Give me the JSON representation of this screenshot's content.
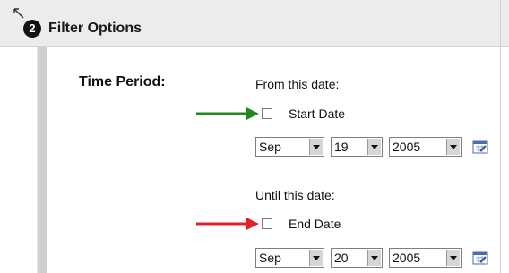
{
  "section": {
    "step_number": "2",
    "title": "Filter Options"
  },
  "time_period": {
    "label": "Time Period:",
    "from": {
      "caption": "From this date:",
      "checkbox_label": "Start Date",
      "checked": false,
      "month": "Sep",
      "day": "19",
      "year": "2005",
      "arrow_color": "#218a1f"
    },
    "until": {
      "caption": "Until this date:",
      "checkbox_label": "End Date",
      "checked": false,
      "month": "Sep",
      "day": "20",
      "year": "2005",
      "arrow_color": "#e4212b"
    }
  },
  "icons": {
    "calendar": "calendar-icon",
    "dropdown": "chevron-down-icon",
    "corner": "corner-arrow-icon"
  }
}
